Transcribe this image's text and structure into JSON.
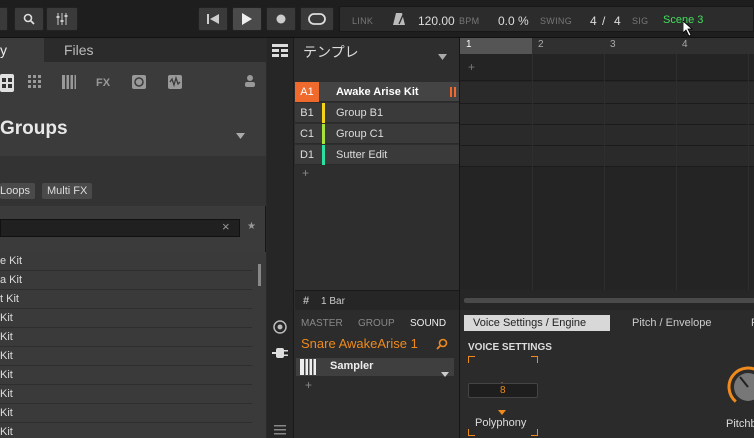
{
  "topbar": {
    "link_label": "LINK",
    "tempo": "120.00",
    "bpm_label": "BPM",
    "swing": "0.0 %",
    "swing_label": "SWING",
    "sig_num": "4",
    "sig_sep": "/",
    "sig_den": "4",
    "sig_label": "SIG",
    "scene": "Scene 3"
  },
  "browser": {
    "tab_partial": "y",
    "tab_files": "Files",
    "groups_title": "Groups",
    "filters": [
      "Loops",
      "Multi FX"
    ],
    "search_clear": "×",
    "search_star": "★",
    "results": [
      "e Kit",
      "a Kit",
      "t Kit",
      "Kit",
      "Kit",
      "Kit",
      "Kit",
      "Kit",
      "Kit",
      "Kit"
    ]
  },
  "grouplist": {
    "header": "テンプレ",
    "groups": [
      {
        "id": "A1",
        "name": "Awake Arise Kit",
        "color": "#ef6a2c"
      },
      {
        "id": "B1",
        "name": "Group B1",
        "color": "#f4d31d"
      },
      {
        "id": "C1",
        "name": "Group C1",
        "color": "#a9e23a"
      },
      {
        "id": "D1",
        "name": "Sutter Edit",
        "color": "#2ee0a0"
      }
    ],
    "add": "+",
    "footer_icon": "#",
    "footer_length": "1 Bar"
  },
  "arranger": {
    "bars": [
      "1",
      "2",
      "3",
      "4"
    ],
    "add": "+"
  },
  "sound": {
    "tab_master": "MASTER",
    "tab_group": "GROUP",
    "tab_sound": "SOUND",
    "sound_name": "Snare AwakeArise 1",
    "plugin": "Sampler",
    "add": "+"
  },
  "params": {
    "tab_voice": "Voice Settings / Engine",
    "tab_pitch": "Pitch / Envelope",
    "tab_cut": "F",
    "section": "VOICE SETTINGS",
    "polyphony_value": "8",
    "polyphony_label": "Polyphony",
    "pitchbend_label": "Pitchb"
  },
  "colors": {
    "accent_orange": "#ef8a1c",
    "scene_green": "#3ee05a"
  }
}
